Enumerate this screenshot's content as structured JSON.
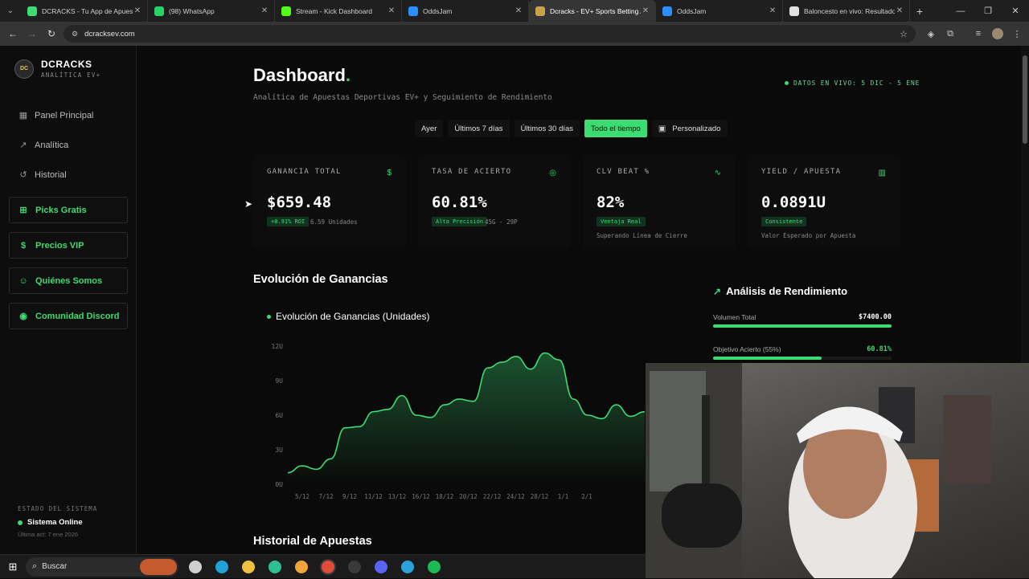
{
  "browser": {
    "tabs": [
      {
        "title": "DCRACKS - Tu App de Apuestas",
        "icon": "bar-chart-favicon",
        "color": "#3ddc72",
        "active": false
      },
      {
        "title": "(98) WhatsApp",
        "icon": "whatsapp-favicon",
        "color": "#25d366",
        "active": false
      },
      {
        "title": "Stream - Kick Dashboard",
        "icon": "kick-favicon",
        "color": "#53fc18",
        "active": false
      },
      {
        "title": "OddsJam",
        "icon": "oddsjam-favicon",
        "color": "#2b8fff",
        "active": false
      },
      {
        "title": "Dcracks - EV+ Sports Betting A",
        "icon": "dcracks-favicon",
        "color": "#c8a24a",
        "active": true
      },
      {
        "title": "OddsJam",
        "icon": "oddsjam-favicon",
        "color": "#2b8fff",
        "active": false
      },
      {
        "title": "Baloncesto en vivo: Resultados",
        "icon": "flashscore-favicon",
        "color": "#e2e2e2",
        "active": false
      }
    ],
    "url": "dcracksev.com"
  },
  "sidebar": {
    "brand_name": "DCRACKS",
    "brand_sub": "ANALÍTICA EV+",
    "nav": [
      {
        "label": "Panel Principal",
        "icon": "grid-icon"
      },
      {
        "label": "Analítica",
        "icon": "trend-icon"
      },
      {
        "label": "Historial",
        "icon": "history-icon"
      }
    ],
    "ctas": [
      {
        "label": "Picks Gratis",
        "icon": "gift-icon"
      },
      {
        "label": "Precios VIP",
        "icon": "dollar-icon"
      },
      {
        "label": "Quiénes Somos",
        "icon": "users-icon"
      },
      {
        "label": "Comunidad Discord",
        "icon": "discord-icon"
      }
    ],
    "system_title": "ESTADO DEL SISTEMA",
    "system_status": "Sistema Online",
    "system_updated": "Última act: 7 ene 2026"
  },
  "header": {
    "title": "Dashboard",
    "title_accent": ".",
    "subtitle": "Analítica de Apuestas Deportivas EV+ y Seguimiento de Rendimiento",
    "live_text": "DATOS EN VIVO: 5 DIC - 5 ENE"
  },
  "filters": {
    "options": [
      "Ayer",
      "Últimos 7 días",
      "Últimos 30 días",
      "Todo el tiempo"
    ],
    "active_index": 3,
    "custom_label": "Personalizado"
  },
  "cards": [
    {
      "label": "GANANCIA TOTAL",
      "icon": "dollar-icon",
      "value": "$659.48",
      "badge": "+8.91% ROI",
      "note": "6.59 Unidades",
      "desc": ""
    },
    {
      "label": "TASA DE ACIERTO",
      "icon": "target-icon",
      "value": "60.81%",
      "badge": "Alta Precisión",
      "note": "45G - 29P",
      "desc": ""
    },
    {
      "label": "CLV BEAT %",
      "icon": "pulse-icon",
      "value": "82%",
      "badge": "Ventaja Real",
      "note": "",
      "desc": "Superando Línea de Cierre"
    },
    {
      "label": "YIELD / APUESTA",
      "icon": "bar-chart-icon",
      "value": "0.0891U",
      "badge": "Consistente",
      "note": "",
      "desc": "Valor Esperado por Apuesta"
    }
  ],
  "sections": {
    "evolution": "Evolución de Ganancias",
    "history": "Historial de Apuestas"
  },
  "performance": {
    "title": "Análisis de Rendimiento",
    "rows": [
      {
        "label": "Volumen Total",
        "value": "$7400.00",
        "fill": 1.0
      },
      {
        "label": "Objetivo Acierto (55%)",
        "value": "60.81%",
        "fill": 0.61
      }
    ]
  },
  "chart_data": {
    "type": "area",
    "title": "Evolución de Ganancias (Unidades)",
    "y_tick_labels": [
      "0U",
      "3U",
      "6U",
      "9U",
      "12U"
    ],
    "ylim": [
      0,
      12
    ],
    "x_tick_labels": [
      "5/12",
      "7/12",
      "9/12",
      "11/12",
      "13/12",
      "16/12",
      "18/12",
      "20/12",
      "22/12",
      "24/12",
      "28/12",
      "1/1",
      "2/1"
    ],
    "series": [
      {
        "color": "#3ddc72",
        "values": [
          1.0,
          1.6,
          1.3,
          2.2,
          4.9,
          5.0,
          6.3,
          6.5,
          7.7,
          6.0,
          5.8,
          6.9,
          7.4,
          7.2,
          10.1,
          10.6,
          11.1,
          10.0,
          11.4,
          10.8,
          7.4,
          6.0,
          5.7,
          6.9,
          5.9,
          6.3
        ]
      }
    ]
  },
  "taskbar": {
    "search_placeholder": "Buscar",
    "apps": [
      {
        "name": "task-view",
        "color": "#cfcfcf"
      },
      {
        "name": "edge",
        "color": "#1fa2d8"
      },
      {
        "name": "explorer",
        "color": "#f0c040"
      },
      {
        "name": "edge-dev",
        "color": "#2dbf91"
      },
      {
        "name": "chrome-canary",
        "color": "#f2a33a"
      },
      {
        "name": "chrome",
        "color": "#e04b3a"
      },
      {
        "name": "obs",
        "color": "#3a3a3a"
      },
      {
        "name": "discord",
        "color": "#5865f2"
      },
      {
        "name": "telegram",
        "color": "#2aa1da"
      },
      {
        "name": "spotify",
        "color": "#1db954"
      }
    ]
  }
}
